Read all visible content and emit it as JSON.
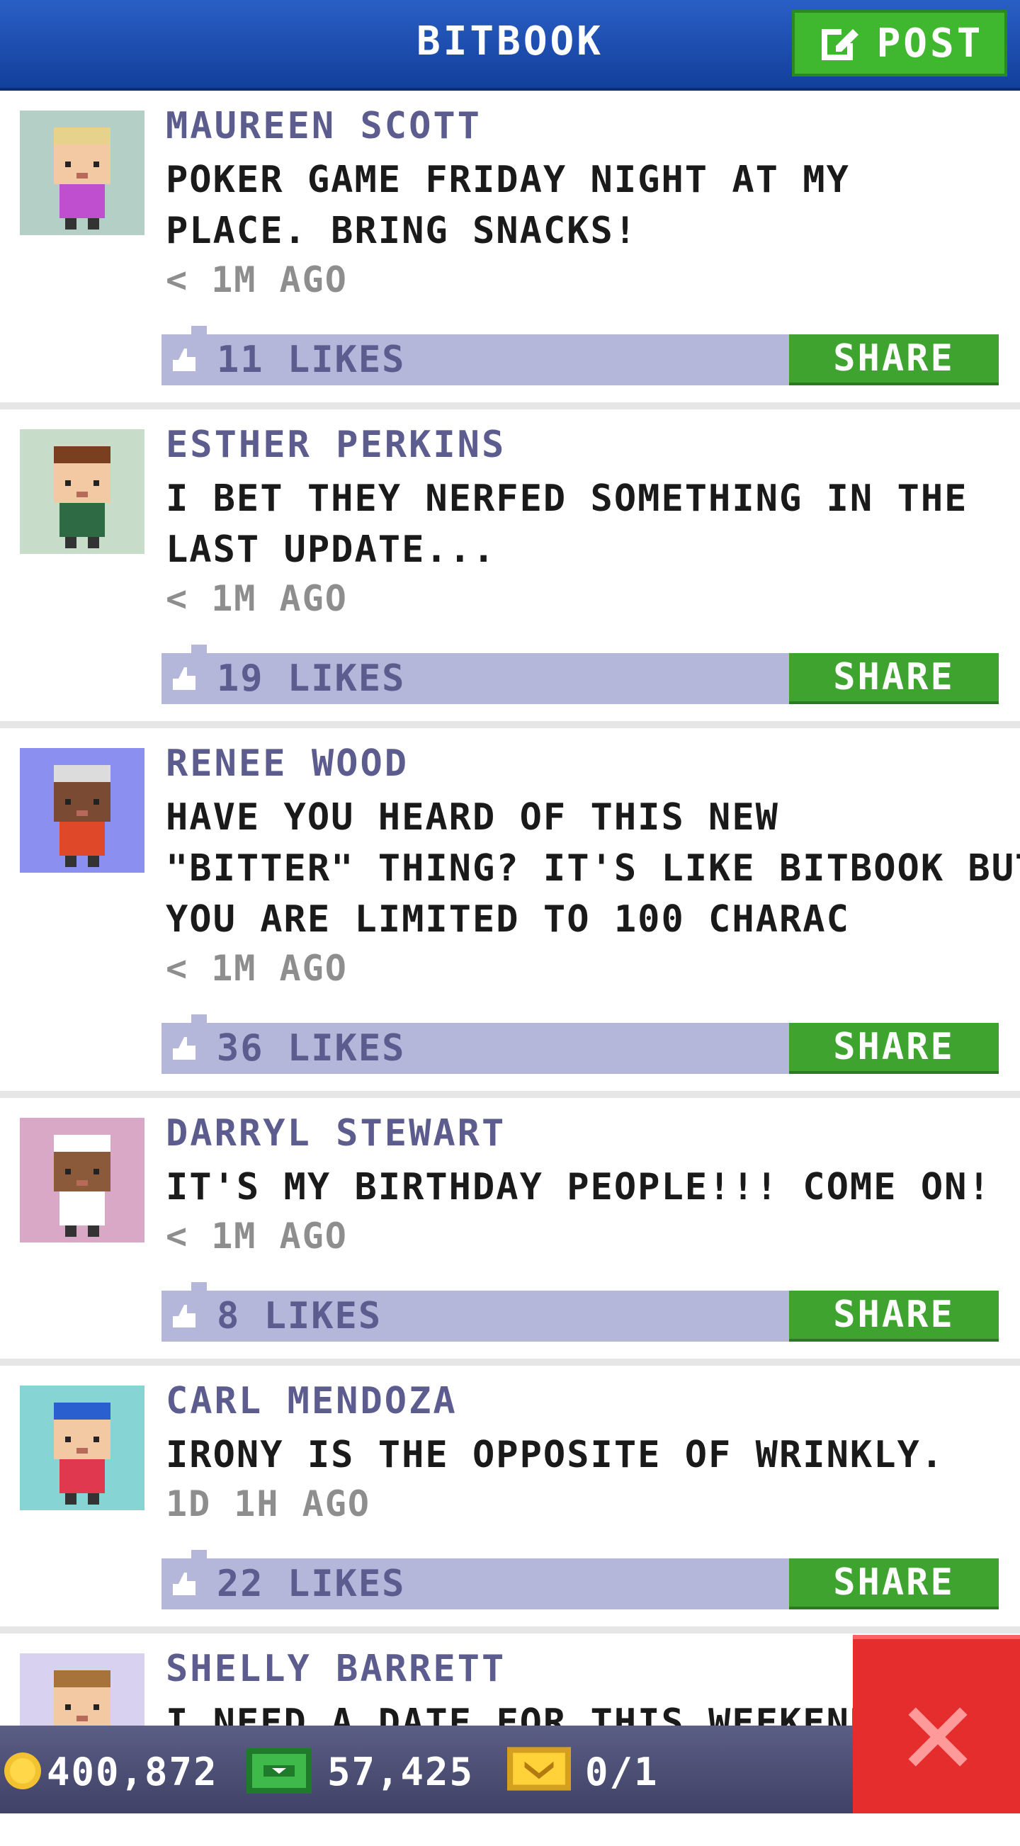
{
  "header": {
    "title": "BITBOOK",
    "post_label": "POST"
  },
  "posts": [
    {
      "author": "MAUREEN SCOTT",
      "lines": [
        "POKER GAME FRIDAY NIGHT AT MY",
        "PLACE. BRING SNACKS!"
      ],
      "time": "< 1M AGO",
      "likes": "11 LIKES",
      "share": "SHARE",
      "avatar_bg": "#b3cfc6",
      "hair": "#e6d28a",
      "skin": "#f3c9a4",
      "shirt": "#c04fcf"
    },
    {
      "author": "ESTHER PERKINS",
      "lines": [
        "I BET THEY NERFED SOMETHING IN THE",
        "LAST UPDATE..."
      ],
      "time": "< 1M AGO",
      "likes": "19 LIKES",
      "share": "SHARE",
      "avatar_bg": "#c7dcc9",
      "hair": "#7a3f1f",
      "skin": "#f3c9a4",
      "shirt": "#2e6b45"
    },
    {
      "author": "RENEE WOOD",
      "lines": [
        "HAVE YOU HEARD OF THIS NEW",
        "\"BITTER\" THING? IT'S LIKE BITBOOK BUT",
        "YOU ARE LIMITED TO 100 CHARAC"
      ],
      "time": "< 1M AGO",
      "likes": "36 LIKES",
      "share": "SHARE",
      "avatar_bg": "#8b8ff0",
      "hair": "#dcdcdc",
      "skin": "#7a4a32",
      "shirt": "#e0482a"
    },
    {
      "author": "DARRYL STEWART",
      "lines": [
        "IT'S MY BIRTHDAY PEOPLE!!! COME ON!"
      ],
      "time": "< 1M AGO",
      "likes": "8 LIKES",
      "share": "SHARE",
      "avatar_bg": "#d9a8c6",
      "hair": "#ffffff",
      "skin": "#8a5a3a",
      "shirt": "#ffffff"
    },
    {
      "author": "CARL MENDOZA",
      "lines": [
        "IRONY IS THE OPPOSITE OF WRINKLY."
      ],
      "time": "1D 1H AGO",
      "likes": "22 LIKES",
      "share": "SHARE",
      "avatar_bg": "#86d4d4",
      "hair": "#2a5fd0",
      "skin": "#f3c9a4",
      "shirt": "#e0384e"
    },
    {
      "author": "SHELLY BARRETT",
      "lines": [
        "I NEED A DATE FOR THIS WEEKEND."
      ],
      "time": "",
      "likes": "",
      "share": "",
      "avatar_bg": "#d8d2f0",
      "hair": "#a8733a",
      "skin": "#f3c9a4",
      "shirt": "#5a2fa0"
    }
  ],
  "footer": {
    "coins": "400,872",
    "bux": "57,425",
    "tickets": "0/1"
  },
  "colors": {
    "header": "#1a4fb0",
    "post_button": "#3fb72f",
    "share_button": "#3fa32f",
    "likes_bar": "#b4b7d9",
    "close_button": "#e52d2d"
  }
}
